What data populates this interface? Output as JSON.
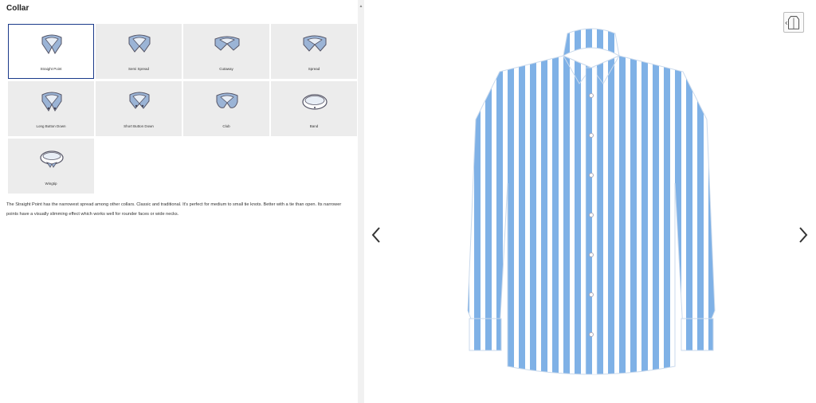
{
  "section": {
    "title": "Collar"
  },
  "collars": [
    {
      "label": "Straight Point",
      "icon": "straight-point-collar-icon",
      "selected": true
    },
    {
      "label": "Semi Spread",
      "icon": "semi-spread-collar-icon",
      "selected": false
    },
    {
      "label": "Cutaway",
      "icon": "cutaway-collar-icon",
      "selected": false
    },
    {
      "label": "Spread",
      "icon": "spread-collar-icon",
      "selected": false
    },
    {
      "label": "Long Button Down",
      "icon": "long-button-down-collar-icon",
      "selected": false
    },
    {
      "label": "Short Button Down",
      "icon": "short-button-down-collar-icon",
      "selected": false
    },
    {
      "label": "Club",
      "icon": "club-collar-icon",
      "selected": false
    },
    {
      "label": "Band",
      "icon": "band-collar-icon",
      "selected": false
    },
    {
      "label": "Wingtip",
      "icon": "wingtip-collar-icon",
      "selected": false
    }
  ],
  "description": "The Straight Point has the narrowest spread among other collars. Classic and traditional. It's perfect for medium to small tie knots. Better with a tie than open. Its narrower points have a visually slimming effect which works well for rounder faces or wide necks.",
  "viewer": {
    "prev_icon": "chevron-left-icon",
    "next_icon": "chevron-right-icon",
    "toggle_icon": "shirt-view-toggle-icon"
  },
  "colors": {
    "stripe": "#7fb1e6",
    "selected_border": "#1a3a8a",
    "tile_bg": "#ececec",
    "collar_fill": "#9bb4d6"
  }
}
